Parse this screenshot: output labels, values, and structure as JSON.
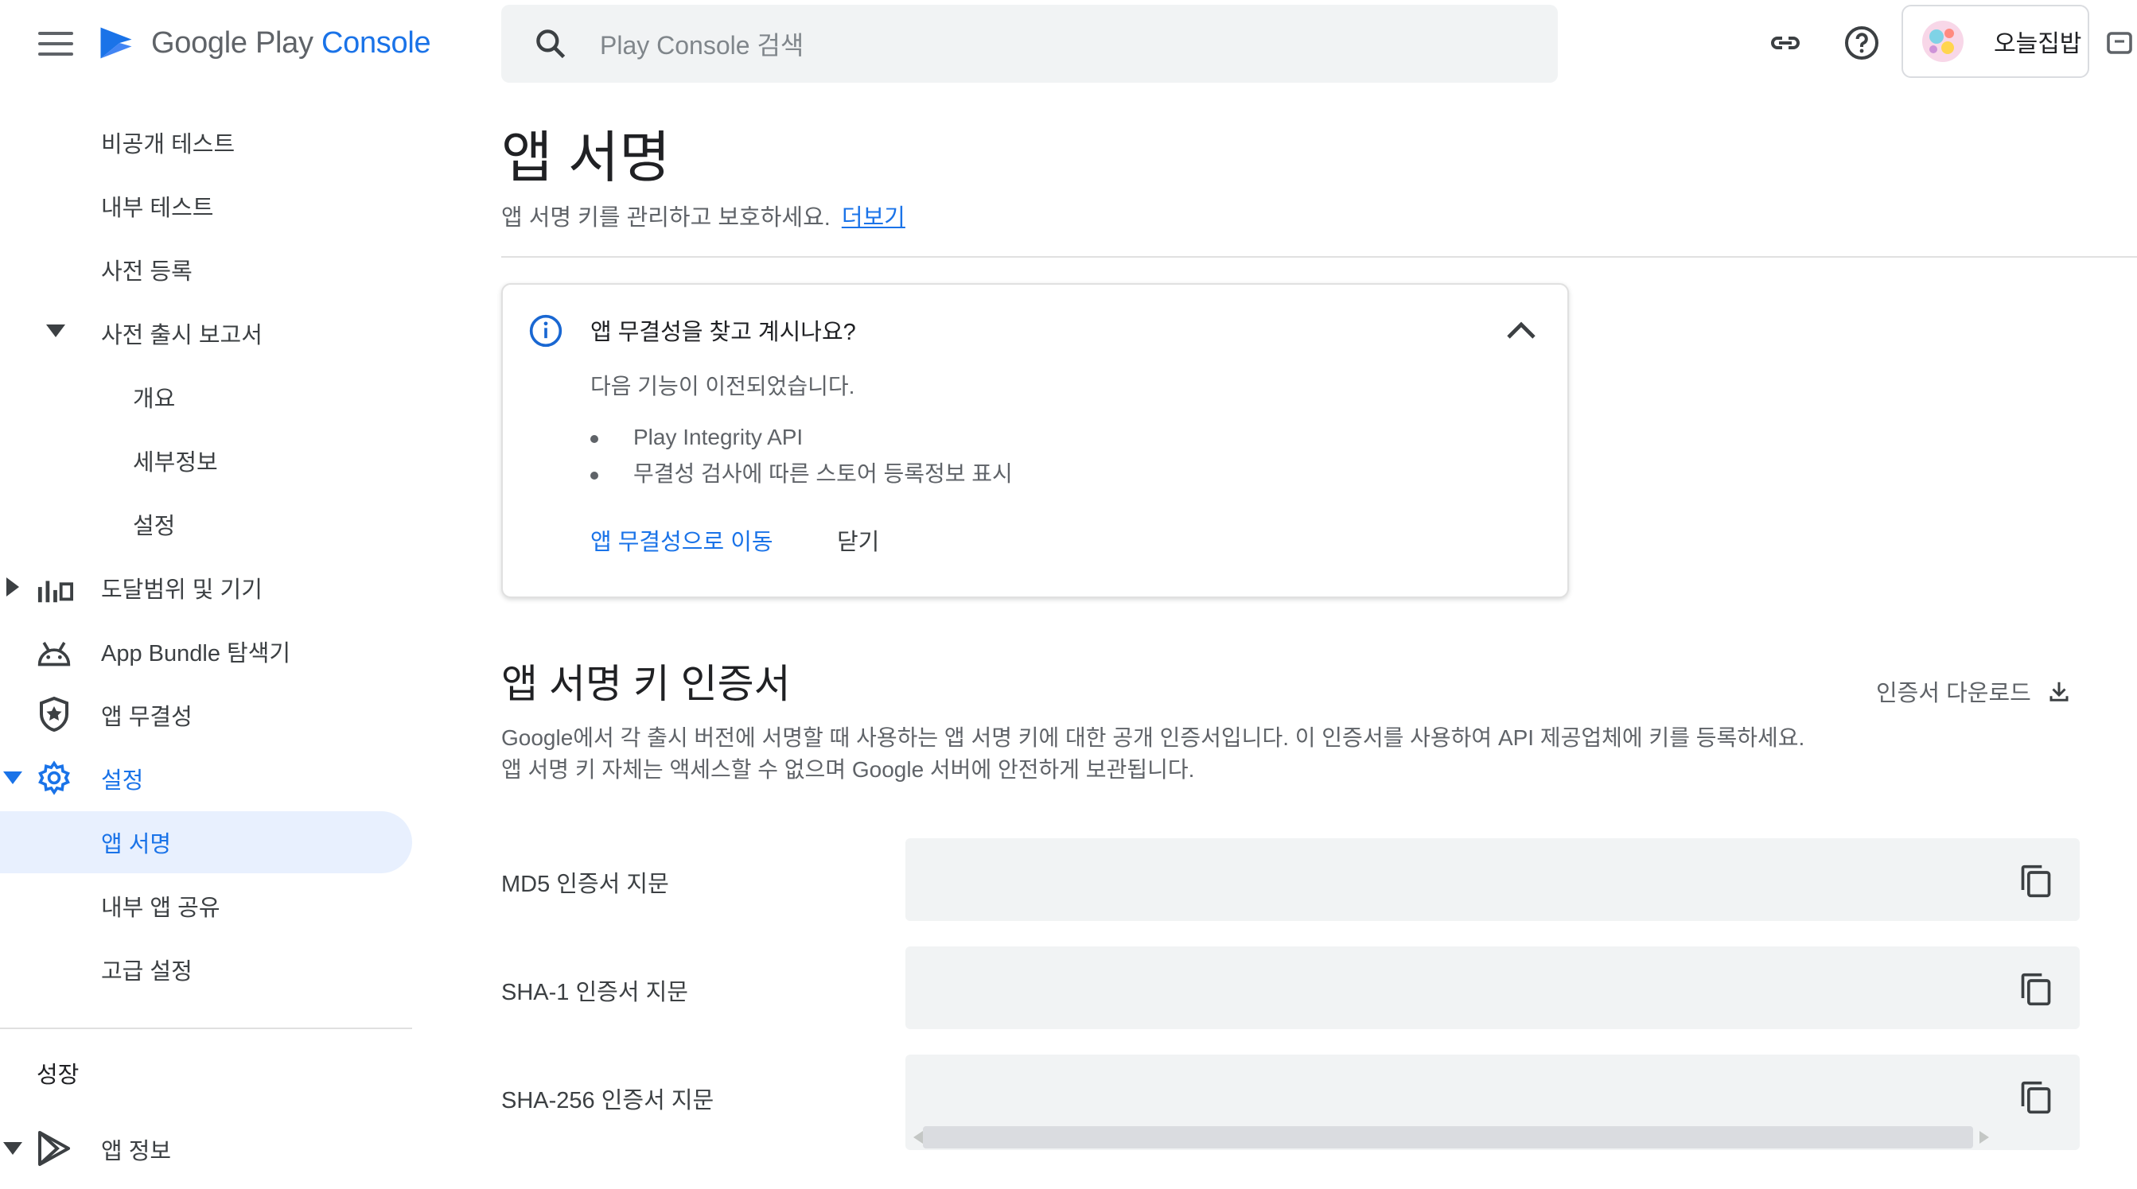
{
  "header": {
    "logo_text_1": "Google Play ",
    "logo_text_2": "Console",
    "search_placeholder": "Play Console 검색",
    "account_name": "오늘집밥"
  },
  "sidebar": {
    "items": [
      {
        "label": "비공개 테스트"
      },
      {
        "label": "내부 테스트"
      },
      {
        "label": "사전 등록"
      },
      {
        "label": "사전 출시 보고서"
      },
      {
        "label": "개요"
      },
      {
        "label": "세부정보"
      },
      {
        "label": "설정"
      },
      {
        "label": "도달범위 및 기기"
      },
      {
        "label": "App Bundle 탐색기"
      },
      {
        "label": "앱 무결성"
      },
      {
        "label": "설정"
      },
      {
        "label": "앱 서명"
      },
      {
        "label": "내부 앱 공유"
      },
      {
        "label": "고급 설정"
      }
    ],
    "section_growth": "성장",
    "app_info": "앱 정보"
  },
  "main": {
    "title": "앱 서명",
    "subtitle": "앱 서명 키를 관리하고 보호하세요.",
    "learn_more": "더보기",
    "card": {
      "title": "앱 무결성을 찾고 계시나요?",
      "body": "다음 기능이 이전되었습니다.",
      "bullets": [
        "Play Integrity API",
        "무결성 검사에 따른 스토어 등록정보 표시"
      ],
      "link": "앱 무결성으로 이동",
      "close": "닫기"
    },
    "section_title": "앱 서명 키 인증서",
    "download": "인증서 다운로드",
    "desc_line1": "Google에서 각 출시 버전에 서명할 때 사용하는 앱 서명 키에 대한 공개 인증서입니다. 이 인증서를 사용하여 API 제공업체에 키를 등록하세요.",
    "desc_line2": "앱 서명 키 자체는 액세스할 수 없으며 Google 서버에 안전하게 보관됩니다.",
    "fingerprints": [
      {
        "label": "MD5 인증서 지문"
      },
      {
        "label": "SHA-1 인증서 지문"
      },
      {
        "label": "SHA-256 인증서 지문"
      }
    ]
  },
  "colors": {
    "accent": "#1a73e8",
    "active_bg": "#e8f0fe",
    "field_bg": "#f1f3f4"
  }
}
